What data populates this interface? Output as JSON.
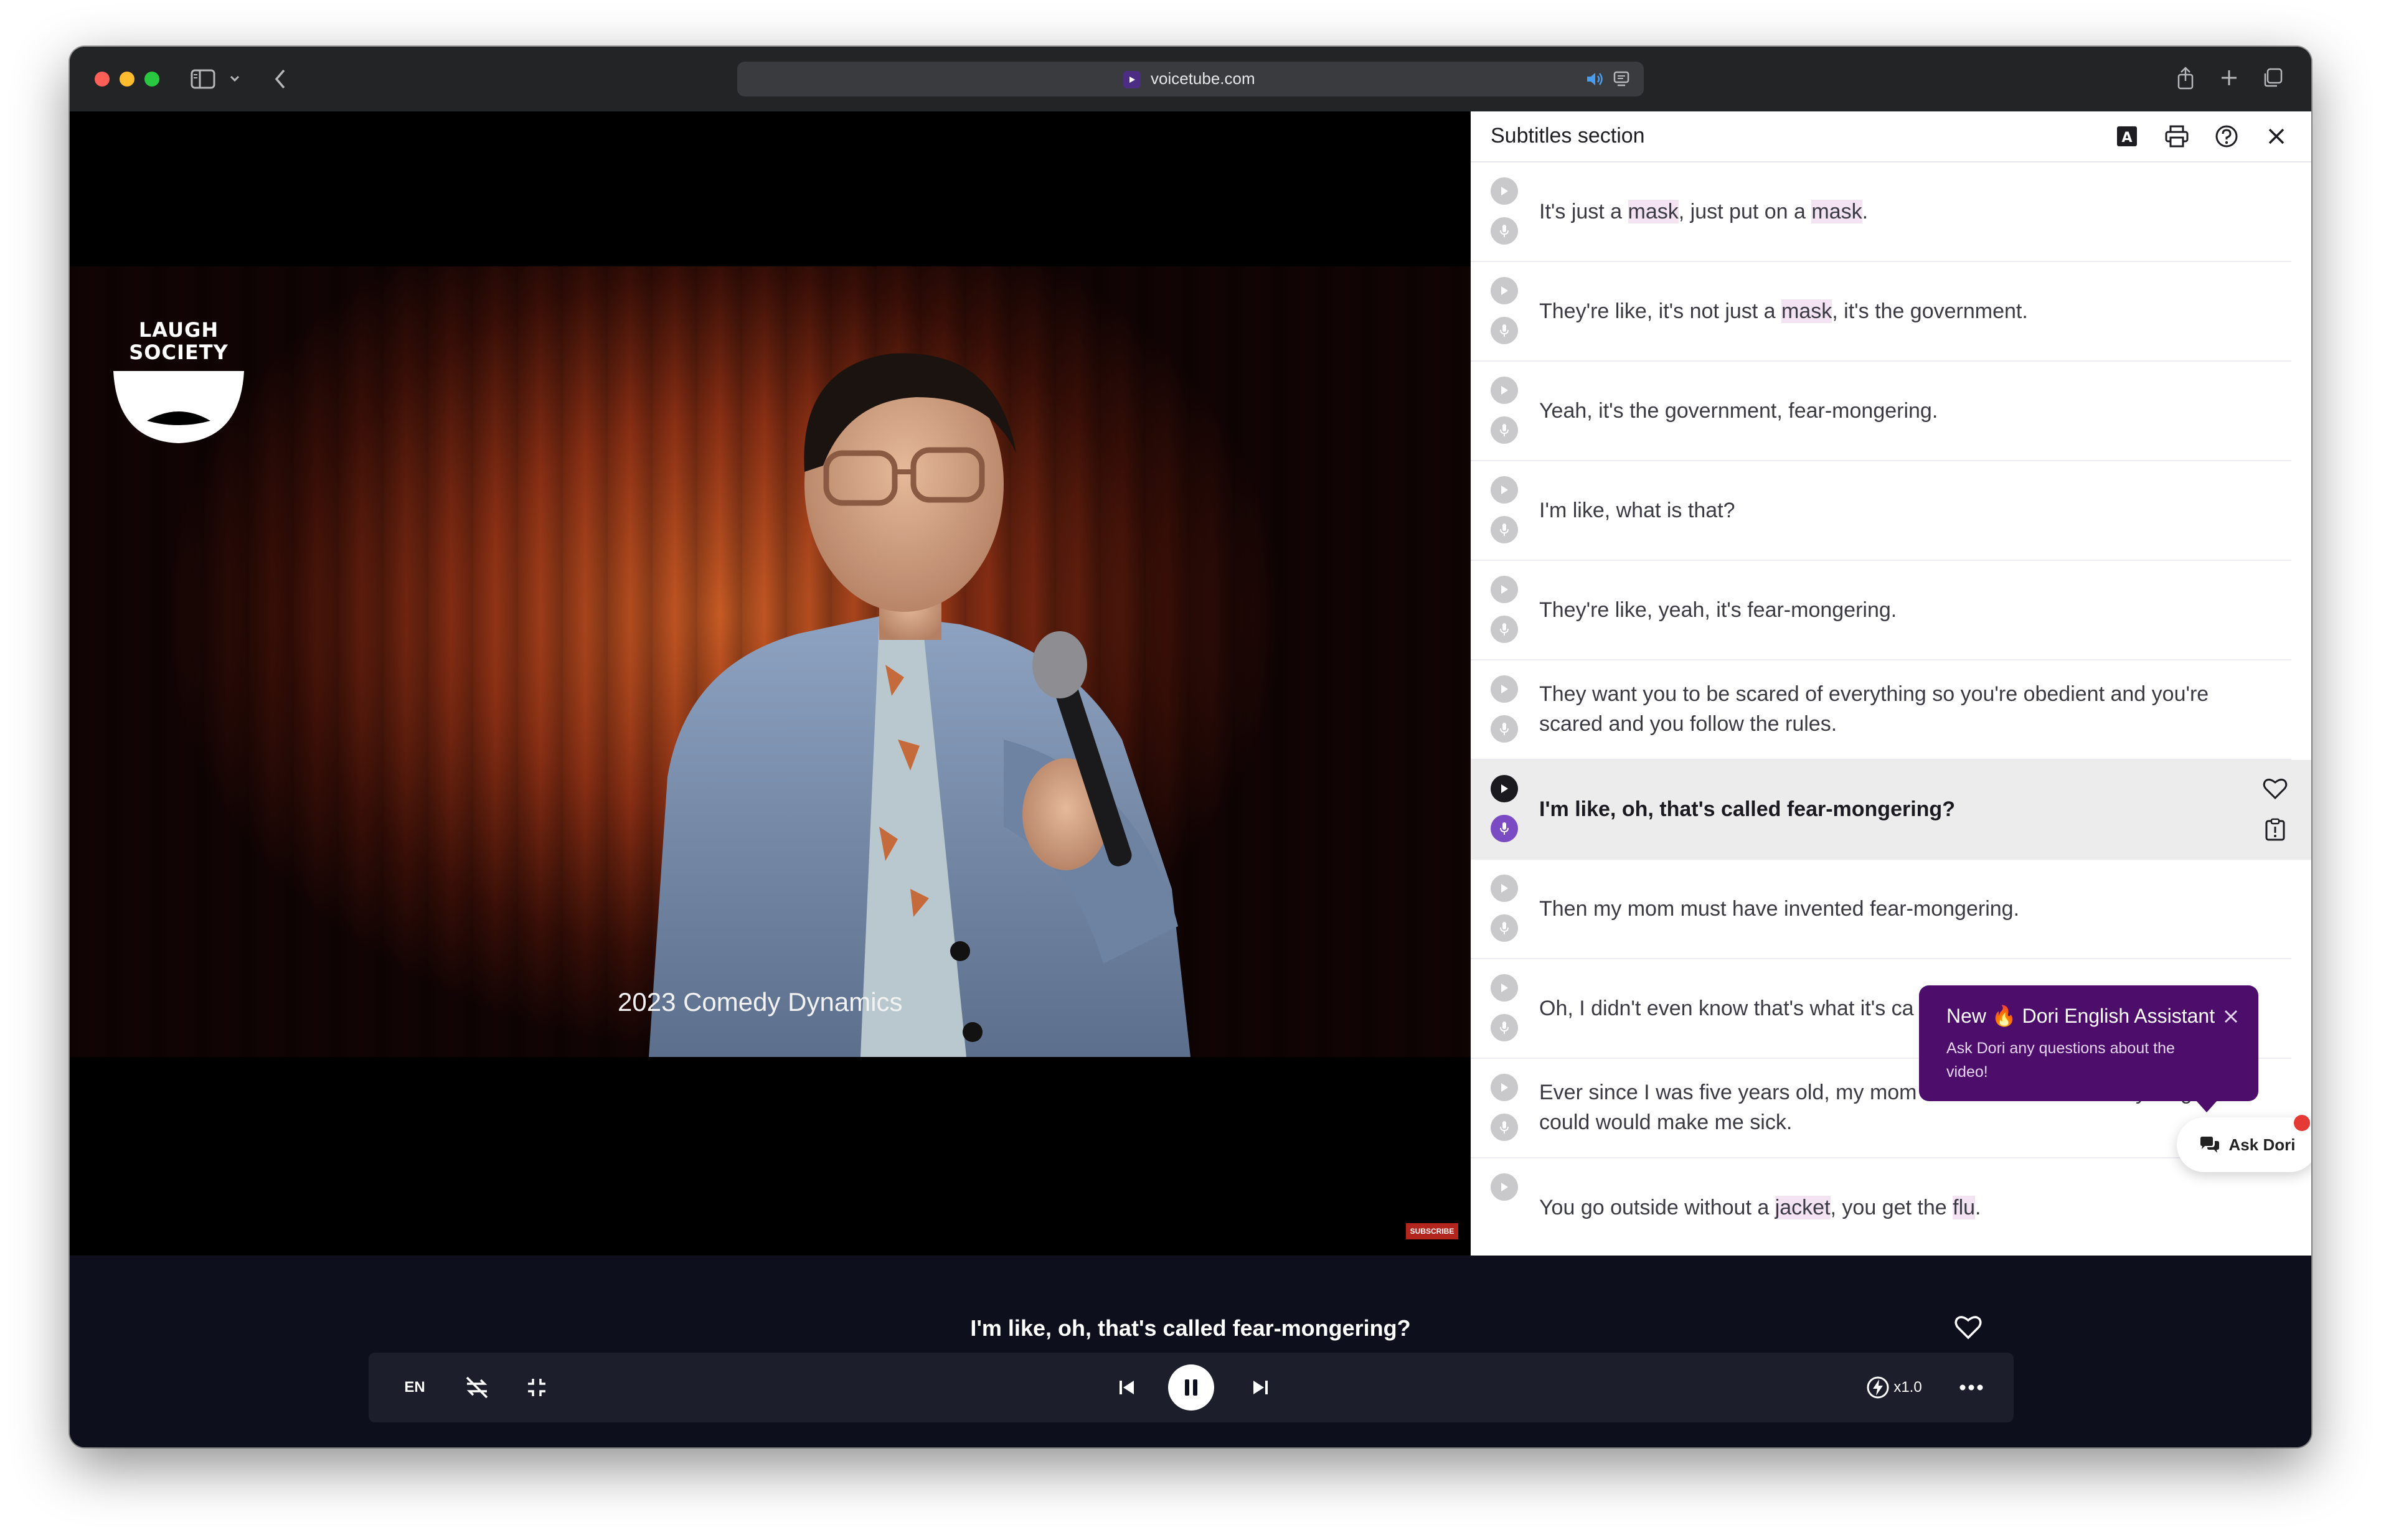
{
  "browser": {
    "url": "voicetube.com",
    "traffic_colors": [
      "#ff5f57",
      "#febc2e",
      "#28c840"
    ]
  },
  "video": {
    "channel_logo_text": "LAUGH SOCIETY",
    "caption_overlay": "2023 Comedy Dynamics",
    "subscribe_badge": "SUBSCRIBE"
  },
  "subtitles_panel": {
    "title": "Subtitles section",
    "header_icons": [
      "font-size-icon",
      "print-icon",
      "help-icon",
      "close-icon"
    ],
    "rows": [
      {
        "text": "It's just a mask, just put on a mask."
      },
      {
        "text": "They're like, it's not just a mask, it's the government."
      },
      {
        "text": "Yeah, it's the government, fear-mongering."
      },
      {
        "text": "I'm like, what is that?"
      },
      {
        "text": "They're like, yeah, it's fear-mongering."
      },
      {
        "text": "They want you to be scared of everything so you're obedient and you're scared and you follow the rules."
      },
      {
        "text": "I'm like, oh, that's called fear-mongering?",
        "active": true
      },
      {
        "text": "Then my mom must have invented fear-mongering."
      },
      {
        "text": "Oh, I didn't even know that's what it's ca"
      },
      {
        "text": "Ever since I was five years old, my mom has me believe that anything could would make me sick."
      },
      {
        "text": "You go outside without a jacket, you get the flu."
      }
    ]
  },
  "assistant": {
    "tooltip_new": "New",
    "tooltip_emoji": "🔥",
    "tooltip_title": "Dori English Assistant",
    "tooltip_body": "Ask Dori any questions about the video!",
    "button_label": "Ask Dori",
    "accent": "#4c0d6b"
  },
  "player": {
    "current_subtitle": "I'm like, oh, that's called fear-mongering?",
    "language": "EN",
    "speed": "x1.0"
  }
}
